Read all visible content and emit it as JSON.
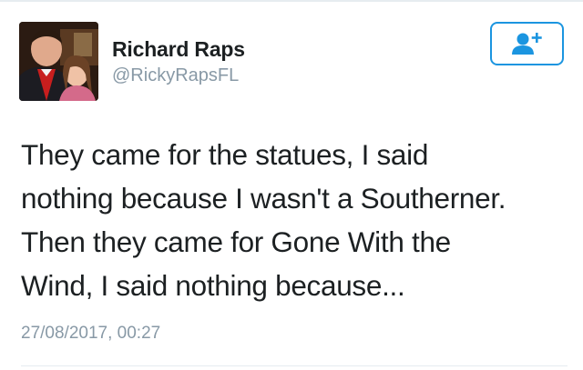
{
  "user": {
    "display_name": "Richard Raps",
    "handle": "@RickyRapsFL",
    "avatar_icon": "profile-photo"
  },
  "follow_button": {
    "icon": "add-user-icon",
    "color": "#1b95e0"
  },
  "tweet": {
    "lines": [
      "They came for the statues, I said",
      "nothing because I wasn't a Southerner.",
      "Then they came for Gone With the",
      "Wind, I said nothing because..."
    ],
    "timestamp": "27/08/2017, 00:27"
  },
  "colors": {
    "text": "#1c2022",
    "muted": "#8899a6",
    "accent": "#1b95e0",
    "divider": "#e6ecf0"
  }
}
